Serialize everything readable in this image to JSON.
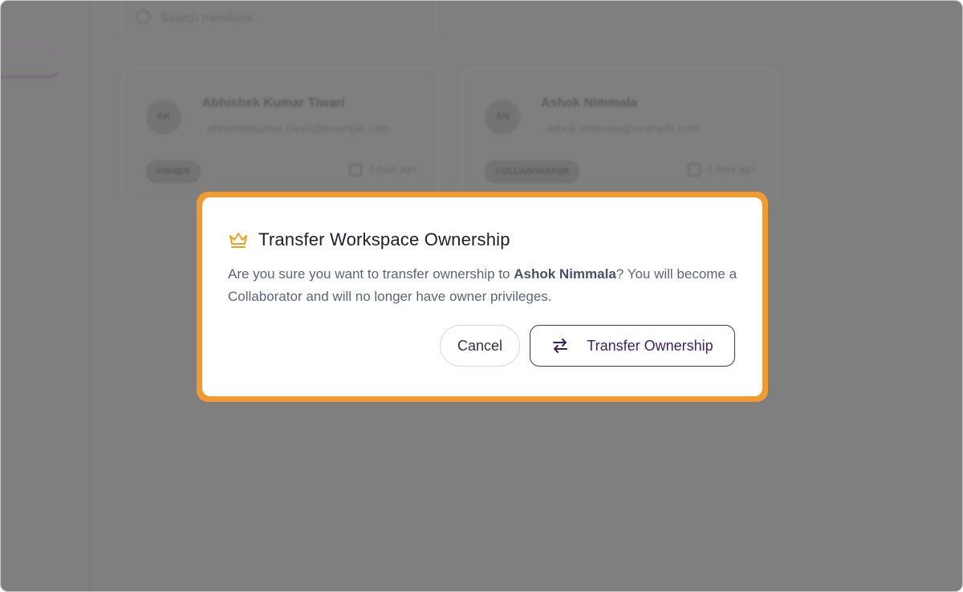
{
  "background": {
    "search_placeholder": "Search members...",
    "members": [
      {
        "initials": "AK",
        "name": "Abhishek Kumar Tiwari",
        "email": "abhishekkumar.tiwari@example.com",
        "role": "OWNER",
        "joined": "3 days ago"
      },
      {
        "initials": "AN",
        "name": "Ashok Nimmala",
        "email": "ashok.nimmala@example.com",
        "role": "COLLABORATOR",
        "joined": "2 days ago"
      }
    ]
  },
  "modal": {
    "icon": "crown-icon",
    "title": "Transfer Workspace Ownership",
    "message_prefix": "Are you sure you want to transfer ownership to ",
    "target_name": "Ashok Nimmala",
    "message_suffix": "? You will become a Collaborator and will no longer have owner privileges.",
    "cancel_label": "Cancel",
    "confirm_label": "Transfer Ownership",
    "confirm_icon": "swap-arrows-icon"
  },
  "colors": {
    "overlay": "#7f7f7f",
    "highlight": "#f39a2e",
    "accent": "#4d2a6a",
    "crown": "#f0a020"
  }
}
